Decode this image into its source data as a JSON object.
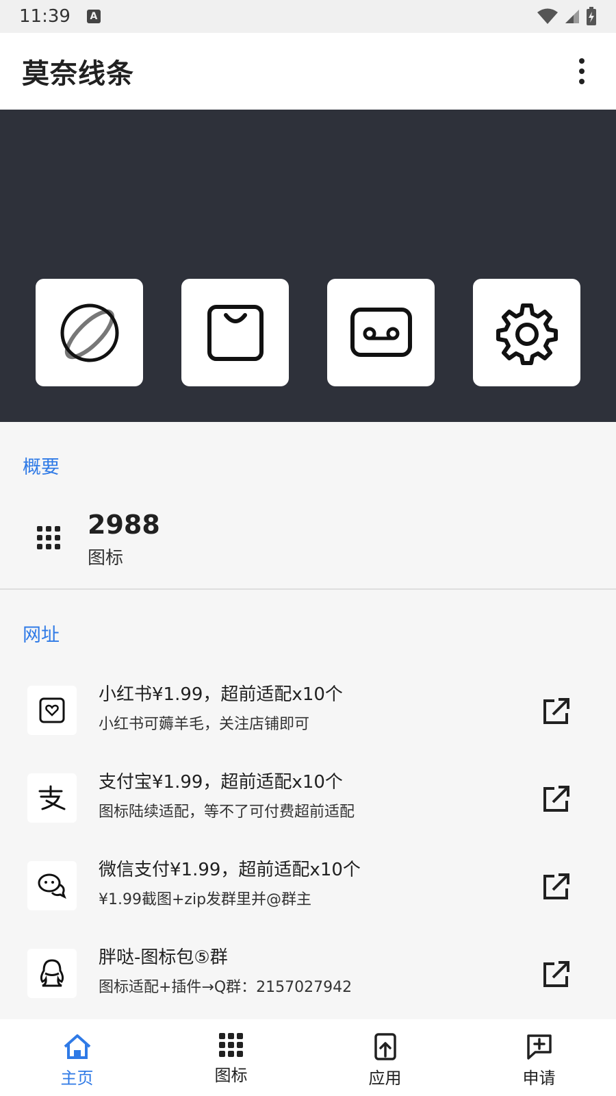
{
  "status_bar": {
    "time": "11:39",
    "notification": "A"
  },
  "app_bar": {
    "title": "莫奈线条"
  },
  "banner": {
    "tiles": [
      "planet-icon",
      "bag-icon",
      "voicemail-icon",
      "gear-icon"
    ]
  },
  "summary": {
    "section_title": "概要",
    "count": "2988",
    "count_label": "图标"
  },
  "links": {
    "section_title": "网址",
    "items": [
      {
        "icon": "xiaohongshu-icon",
        "title": "小红书¥1.99，超前适配x10个",
        "subtitle": "小红书可薅羊毛，关注店铺即可"
      },
      {
        "icon": "alipay-icon",
        "title": "支付宝¥1.99，超前适配x10个",
        "subtitle": "图标陆续适配，等不了可付费超前适配"
      },
      {
        "icon": "wechat-icon",
        "title": "微信支付¥1.99，超前适配x10个",
        "subtitle": "¥1.99截图+zip发群里并@群主"
      },
      {
        "icon": "qq-icon",
        "title": "胖哒-图标包⑤群",
        "subtitle": "图标适配+插件→Q群：2157027942"
      }
    ]
  },
  "bottom_nav": {
    "items": [
      {
        "label": "主页",
        "icon": "home-icon",
        "active": true
      },
      {
        "label": "图标",
        "icon": "grid-icon",
        "active": false
      },
      {
        "label": "应用",
        "icon": "app-upload-icon",
        "active": false
      },
      {
        "label": "申请",
        "icon": "request-icon",
        "active": false
      }
    ]
  },
  "colors": {
    "accent": "#2f7ae6",
    "banner_bg": "#2e313a",
    "page_bg": "#f6f6f6"
  }
}
